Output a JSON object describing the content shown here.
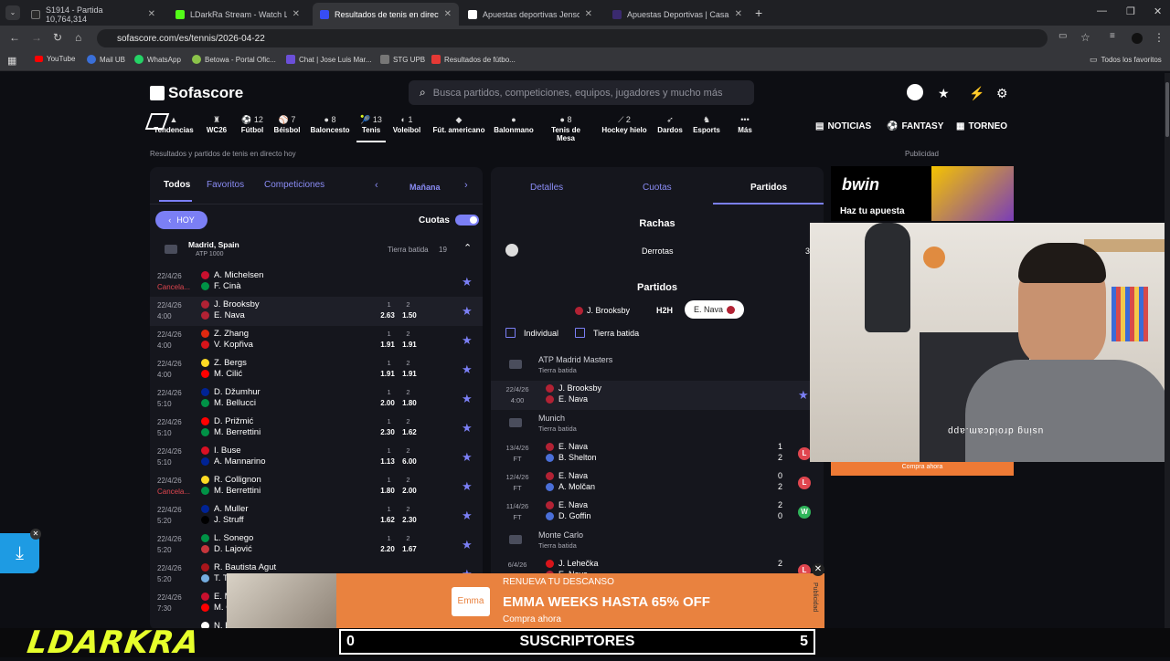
{
  "browser": {
    "tabs": [
      {
        "title": "S1914 - Partida 10,764,314",
        "color": "#2b2b2b"
      },
      {
        "title": "LDarkRa Stream - Watch Live on",
        "color": "#53fc18"
      },
      {
        "title": "Resultados de tenis en directo y",
        "color": "#374df5"
      },
      {
        "title": "Apuestas deportivas Jenson Br...",
        "color": "#ffffff"
      },
      {
        "title": "Apuestas Deportivas | Casa de A...",
        "color": "#3a2a6e"
      }
    ],
    "url": "sofascore.com/es/tennis/2026-04-22",
    "bookmarks": [
      "YouTube",
      "Mail UB",
      "WhatsApp",
      "Betowa - Portal Ofic...",
      "Chat | Jose Luis Mar...",
      "STG UPB",
      "Resultados de fútbo..."
    ],
    "all_bookmarks": "Todos los favoritos"
  },
  "site": {
    "logo": "Sofascore",
    "search_placeholder": "Busca partidos, competiciones, equipos, jugadores y mucho más",
    "sports": [
      {
        "label": "Tendencias",
        "count": ""
      },
      {
        "label": "WC26",
        "count": ""
      },
      {
        "label": "Fútbol",
        "count": "12"
      },
      {
        "label": "Béisbol",
        "count": "7"
      },
      {
        "label": "Baloncesto",
        "count": "8"
      },
      {
        "label": "Tenis",
        "count": "13"
      },
      {
        "label": "Voleibol",
        "count": "1"
      },
      {
        "label": "Fút. americano",
        "count": ""
      },
      {
        "label": "Balonmano",
        "count": ""
      },
      {
        "label": "Tenis de Mesa",
        "count": "8"
      },
      {
        "label": "Hockey hielo",
        "count": "2"
      },
      {
        "label": "Dardos",
        "count": ""
      },
      {
        "label": "Esports",
        "count": ""
      },
      {
        "label": "Más",
        "count": ""
      }
    ],
    "right_nav": [
      "NOTICIAS",
      "FANTASY",
      "TORNEO"
    ],
    "breadcrumb": "Resultados y partidos de tenis en directo hoy",
    "publicidad": "Publicidad"
  },
  "left": {
    "tabs": [
      "Todos",
      "Favoritos",
      "Competiciones"
    ],
    "day": "Mañana",
    "hoy": "HOY",
    "cuotas": "Cuotas",
    "tournament": {
      "name": "Madrid, Spain",
      "sub": "ATP 1000",
      "surface": "Tierra batida",
      "count": "19"
    },
    "matches": [
      {
        "date": "22/4/26",
        "status": "Cancela...",
        "p1": "A. Michelsen",
        "p2": "F. Cinà",
        "o1": "",
        "o2": "",
        "c1": "#c8102e",
        "c2": "#009246"
      },
      {
        "date": "22/4/26",
        "status": "4:00",
        "p1": "J. Brooksby",
        "p2": "E. Nava",
        "o1": "2.63",
        "o2": "1.50",
        "c1": "#b22234",
        "c2": "#b22234"
      },
      {
        "date": "22/4/26",
        "status": "4:00",
        "p1": "Z. Zhang",
        "p2": "V. Kopřiva",
        "o1": "1.91",
        "o2": "1.91",
        "c1": "#de2910",
        "c2": "#d7141a"
      },
      {
        "date": "22/4/26",
        "status": "4:00",
        "p1": "Z. Bergs",
        "p2": "M. Cilić",
        "o1": "1.91",
        "o2": "1.91",
        "c1": "#fdda24",
        "c2": "#ff0000"
      },
      {
        "date": "22/4/26",
        "status": "5:10",
        "p1": "D. Džumhur",
        "p2": "M. Bellucci",
        "o1": "2.00",
        "o2": "1.80",
        "c1": "#002395",
        "c2": "#009246"
      },
      {
        "date": "22/4/26",
        "status": "5:10",
        "p1": "D. Prižmić",
        "p2": "M. Berrettini",
        "o1": "2.30",
        "o2": "1.62",
        "c1": "#ff0000",
        "c2": "#009246"
      },
      {
        "date": "22/4/26",
        "status": "5:10",
        "p1": "I. Buse",
        "p2": "A. Mannarino",
        "o1": "1.13",
        "o2": "6.00",
        "c1": "#d91023",
        "c2": "#002395"
      },
      {
        "date": "22/4/26",
        "status": "Cancela...",
        "p1": "R. Collignon",
        "p2": "M. Berrettini",
        "o1": "1.80",
        "o2": "2.00",
        "c1": "#fdda24",
        "c2": "#009246"
      },
      {
        "date": "22/4/26",
        "status": "5:20",
        "p1": "A. Muller",
        "p2": "J. Struff",
        "o1": "1.62",
        "o2": "2.30",
        "c1": "#002395",
        "c2": "#000000"
      },
      {
        "date": "22/4/26",
        "status": "5:20",
        "p1": "L. Sonego",
        "p2": "D. Lajović",
        "o1": "2.20",
        "o2": "1.67",
        "c1": "#009246",
        "c2": "#c6363c"
      },
      {
        "date": "22/4/26",
        "status": "5:20",
        "p1": "R. Bautista Agut",
        "p2": "T. Ti...",
        "o1": "",
        "o2": "",
        "c1": "#aa151b",
        "c2": "#74acdf"
      },
      {
        "date": "22/4/26",
        "status": "7:30",
        "p1": "E. M...",
        "p2": "M. Ci...",
        "o1": "",
        "o2": "",
        "c1": "#c8102e",
        "c2": "#ff0000"
      },
      {
        "date": "",
        "status": "",
        "p1": "N. B...",
        "p2": "",
        "o1": "",
        "o2": "",
        "c1": "#ffffff",
        "c2": "#ffffff"
      }
    ]
  },
  "mid": {
    "tabs": [
      "Detalles",
      "Cuotas",
      "Partidos"
    ],
    "rachas": "Rachas",
    "derrotas": "Derrotas",
    "derrotas_count": "3",
    "partidos": "Partidos",
    "h2h": [
      "J. Brooksby",
      "H2H",
      "E. Nava"
    ],
    "filters": [
      "Individual",
      "Tierra batida"
    ],
    "groups": [
      {
        "name": "ATP Madrid Masters",
        "surface": "Tierra batida"
      },
      {
        "name": "Munich",
        "surface": "Tierra batida"
      },
      {
        "name": "Monte Carlo",
        "surface": "Tierra batida"
      }
    ],
    "current": {
      "date": "22/4/26",
      "status": "4:00",
      "p1": "J. Brooksby",
      "p2": "E. Nava"
    },
    "results": [
      {
        "date": "13/4/26",
        "status": "FT",
        "p1": "E. Nava",
        "p2": "B. Shelton",
        "s1": "1",
        "s2": "2",
        "badge": "L",
        "bcolor": "#e0464f"
      },
      {
        "date": "12/4/26",
        "status": "FT",
        "p1": "E. Nava",
        "p2": "A. Molčan",
        "s1": "0",
        "s2": "2",
        "badge": "L",
        "bcolor": "#e0464f"
      },
      {
        "date": "11/4/26",
        "status": "FT",
        "p1": "E. Nava",
        "p2": "D. Goffin",
        "s1": "2",
        "s2": "0",
        "badge": "W",
        "bcolor": "#2fb45a"
      }
    ],
    "last": {
      "date": "6/4/26",
      "p1": "J. Lehečka",
      "p2": "E. Nava",
      "s1": "2",
      "badge": "L"
    }
  },
  "ads": {
    "bwin": "bwin",
    "bwin_text": "Haz tu apuesta",
    "compra": "Compra ahora",
    "banner_top": "RENUEVA TU DESCANSO",
    "banner_main": "EMMA WEEKS HASTA 65% OFF",
    "banner_cta": "Compra ahora",
    "banner_logo": "Emma",
    "publicidad_side": "Publicidad"
  },
  "stream": {
    "subs_left": "0",
    "subs_label": "SUSCRIPTORES",
    "subs_right": "5",
    "brand": "LDARKRA",
    "cam_text": "using droidcam.app"
  }
}
